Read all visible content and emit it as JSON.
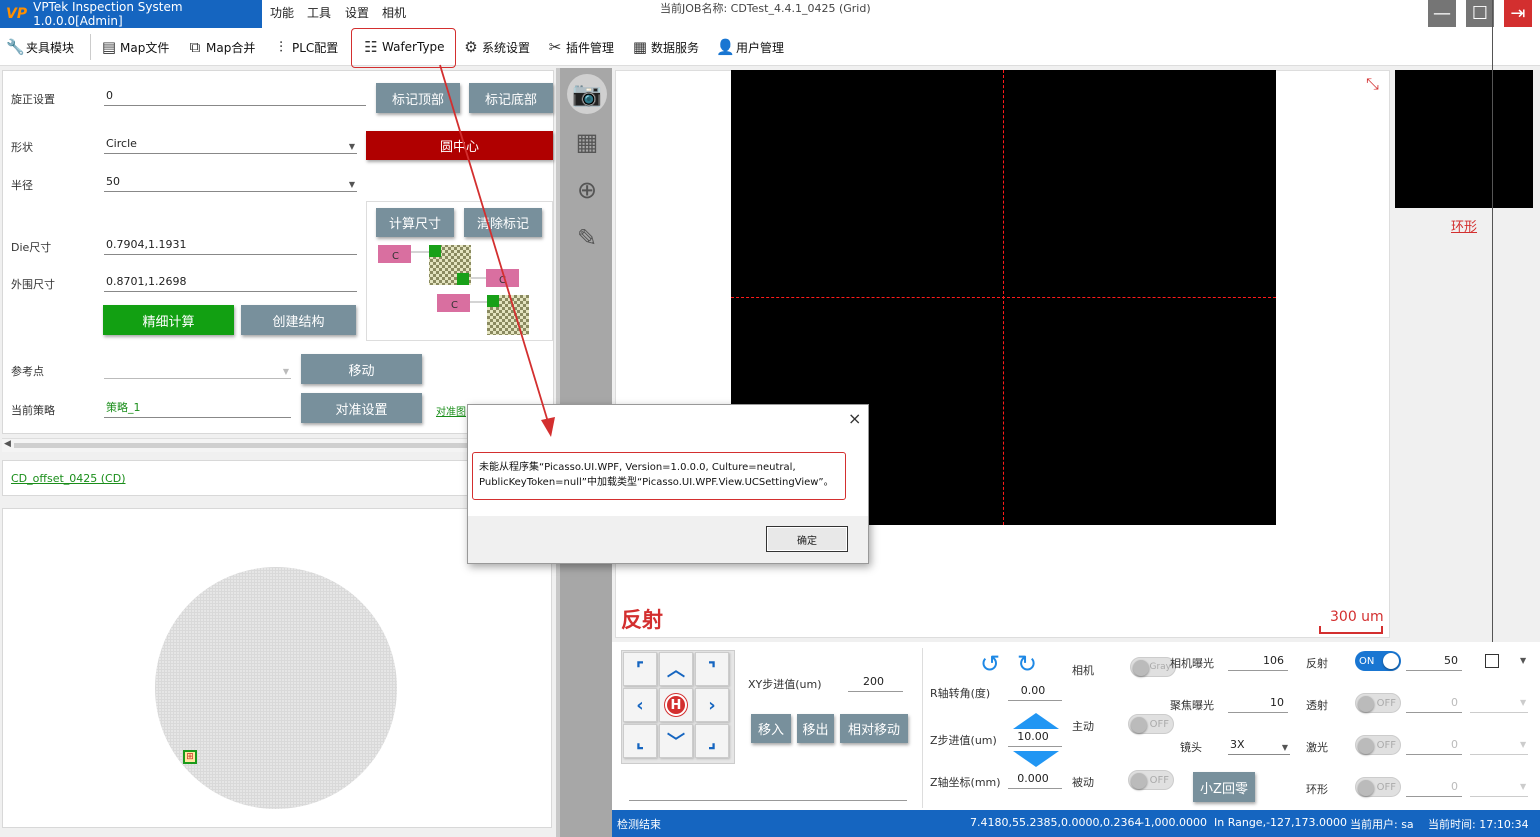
{
  "titlebar": {
    "app_title": "VPTek Inspection System 1.0.0.0[Admin]",
    "menu": [
      "功能",
      "工具",
      "设置",
      "相机"
    ],
    "job_name": "当前JOB名称:  CDTest_4.4.1_0425 (Grid)"
  },
  "toolbar": {
    "items": [
      "夹具模块",
      "Map文件",
      "Map合并",
      "PLC配置",
      "WaferType",
      "系统设置",
      "插件管理",
      "数据服务",
      "用户管理"
    ]
  },
  "wafer_settings": {
    "rotation_label": "旋正设置",
    "rotation_value": "0",
    "mark_top": "标记顶部",
    "mark_bottom": "标记底部",
    "shape_label": "形状",
    "shape_value": "Circle",
    "circle_center": "圆中心",
    "radius_label": "半径",
    "radius_value": "50",
    "calc_size": "计算尺寸",
    "clear_marks": "清除标记",
    "die_size_label": "Die尺寸",
    "die_size_value": "0.7904,1.1931",
    "outer_size_label": "外围尺寸",
    "outer_size_value": "0.8701,1.2698",
    "fine_calc": "精细计算",
    "create_struct": "创建结构",
    "ref_point_label": "参考点",
    "move": "移动",
    "strategy_label": "当前策略",
    "strategy_value": "策略_1",
    "align_settings": "对准设置",
    "align_link": "对准图",
    "marker_c": "C"
  },
  "recipe_link": "CD_offset_0425 (CD)",
  "camera": {
    "label": "反射",
    "scale": "300 um",
    "ring_label": "环形"
  },
  "motion": {
    "xy_step_label": "XY步进值(um)",
    "xy_step_value": "200",
    "move_in": "移入",
    "move_out": "移出",
    "relative_move": "相对移动",
    "r_angle_label": "R轴转角(度)",
    "r_angle_value": "0.00",
    "z_step_label": "Z步进值(um)",
    "z_step_value": "10.00",
    "z_coord_label": "Z轴坐标(mm)",
    "z_coord_value": "0.000",
    "home_label": "H"
  },
  "camera_ctrl": {
    "camera_label": "相机",
    "gray_label": "Gray",
    "exposure_label": "相机曝光",
    "exposure_value": "106",
    "active_label": "主动",
    "focus_exposure_label": "聚焦曝光",
    "focus_exposure_value": "10",
    "lens_label": "镜头",
    "lens_value": "3X",
    "passive_label": "被动",
    "small_z_home": "小Z回零",
    "off": "OFF",
    "on": "ON"
  },
  "lights": [
    {
      "label": "反射",
      "state": "ON",
      "value": "50"
    },
    {
      "label": "透射",
      "state": "OFF",
      "value": "0"
    },
    {
      "label": "激光",
      "state": "OFF",
      "value": "0"
    },
    {
      "label": "环形",
      "state": "OFF",
      "value": "0"
    }
  ],
  "status": {
    "message": "检测结束",
    "coords": "7.4180,55.2385,0.0000,0.2364",
    "z": "-1,000.0000",
    "range": "In Range,-127,173.0000",
    "user": "当前用户:  sa",
    "time": "当前时间:  17:10:34"
  },
  "dialog": {
    "message": "未能从程序集“Picasso.UI.WPF, Version=1.0.0.0, Culture=neutral, PublicKeyToken=null”中加载类型“Picasso.UI.WPF.View.UCSettingView”。",
    "ok": "确定",
    "close": "×"
  },
  "colors": {
    "title_blue": "#1565c0",
    "highlight_red": "#d32f2f",
    "button_gray": "#78909c",
    "button_green": "#12a012",
    "button_red": "#b00000",
    "crosshair": "#ff1a1a"
  }
}
